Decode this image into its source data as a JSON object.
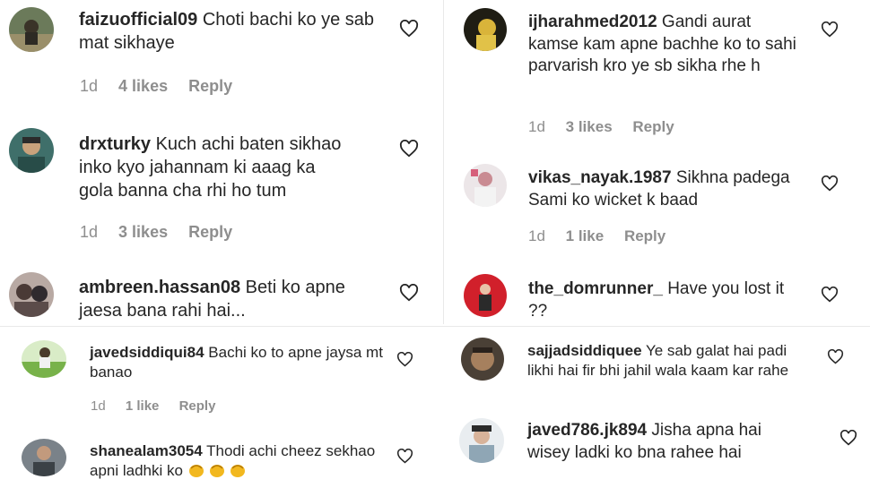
{
  "comments": {
    "c1": {
      "username": "faizuofficial09",
      "text": "Choti bachi ko ye sab mat sikhaye",
      "day": "1d",
      "likes": "4 likes",
      "reply": "Reply"
    },
    "c2": {
      "username": "drxturky",
      "text": "Kuch achi baten sikhao inko kyo jahannam ki aaag ka gola banna cha rhi ho tum",
      "day": "1d",
      "likes": "3 likes",
      "reply": "Reply"
    },
    "c3": {
      "username": "ambreen.hassan08",
      "text": "Beti ko apne jaesa bana rahi hai..."
    },
    "c4": {
      "username": "ijharahmed2012",
      "text": "Gandi aurat kamse kam apne bachhe ko to sahi parvarish kro ye sb sikha rhe h",
      "day": "1d",
      "likes": "3 likes",
      "reply": "Reply"
    },
    "c5": {
      "username": "vikas_nayak.1987",
      "text": "Sikhna padega Sami ko wicket k baad",
      "day": "1d",
      "likes": "1 like",
      "reply": "Reply"
    },
    "c6": {
      "username": "the_domrunner_",
      "text": "Have you lost it ??"
    },
    "c7": {
      "username": "javedsiddiqui84",
      "text": "Bachi ko to apne jaysa mt banao",
      "day": "1d",
      "likes": "1 like",
      "reply": "Reply"
    },
    "c8": {
      "username": "shanealam3054",
      "text": "Thodi achi cheez sekhao apni ladhki ko",
      "emoji": "clapping-hands-emoji"
    },
    "c9": {
      "username": "sajjadsiddiquee",
      "text": "Ye sab galat hai padi likhi hai fir bhi jahil wala kaam kar rahe"
    },
    "c10": {
      "username": "javed786.jk894",
      "text": "Jisha apna hai wisey ladki ko bna rahee hai"
    }
  },
  "colors": {
    "text": "#262626",
    "meta": "#8e8e8e",
    "background": "#ffffff"
  }
}
